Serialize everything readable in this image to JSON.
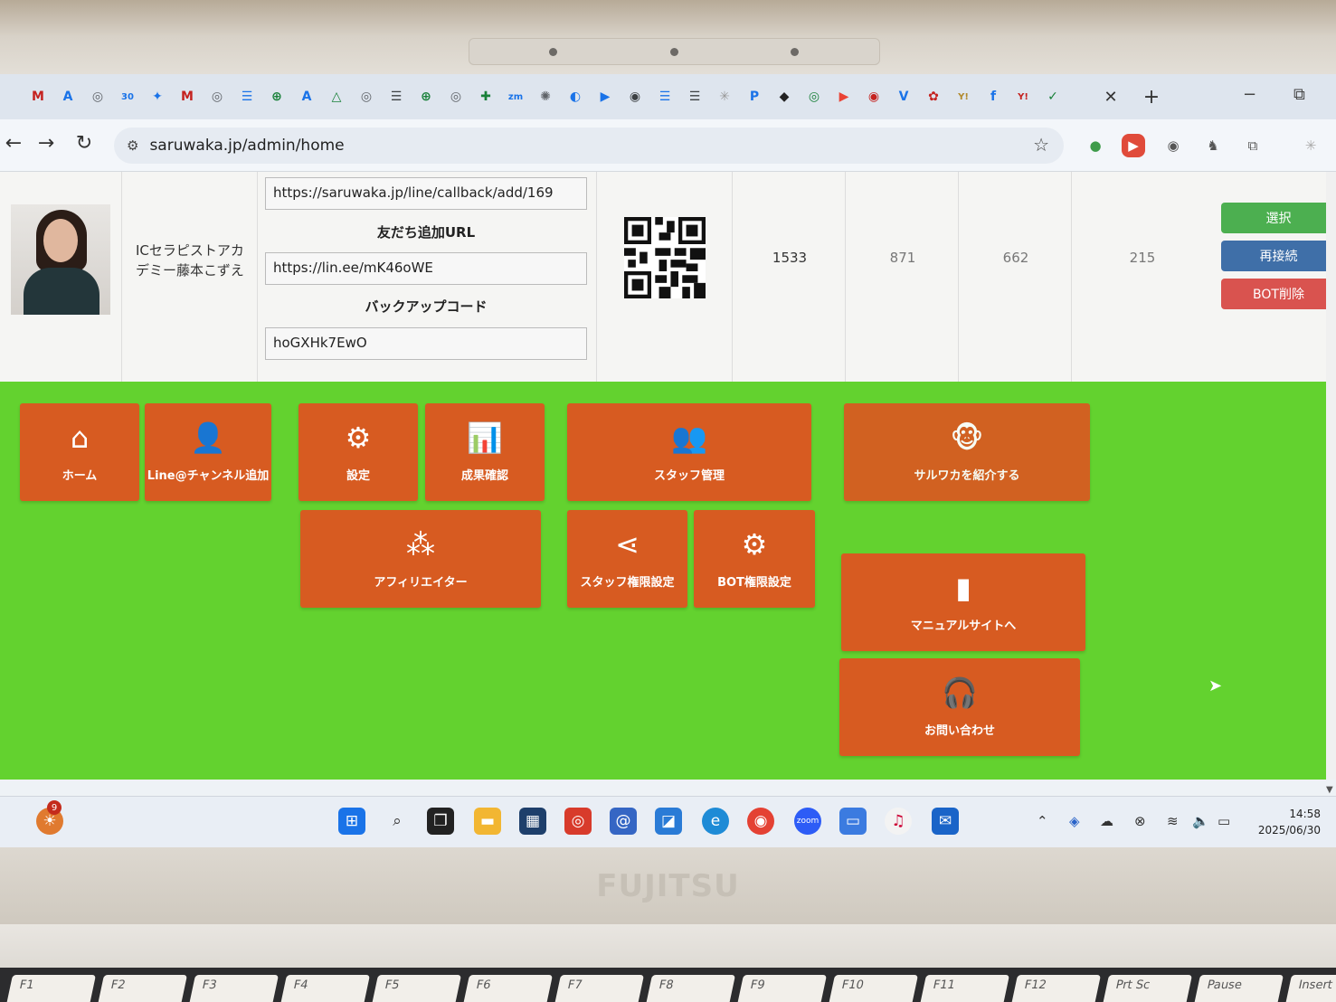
{
  "browser": {
    "tab_favicons": [
      "M",
      "A",
      "◎",
      "30",
      "✦",
      "M",
      "◎",
      "☰",
      "⊕",
      "A",
      "△",
      "◎",
      "☰",
      "⊕",
      "◎",
      "✚",
      "zm",
      "✺",
      "◐",
      "▶",
      "◉",
      "☰",
      "☰",
      "✳",
      "P",
      "◆",
      "◎",
      "▶",
      "◉",
      "V",
      "✿",
      "Y!",
      "f",
      "Y!",
      "✓"
    ],
    "close_icon": "✕",
    "new_tab_icon": "+",
    "minimize": "−",
    "restore": "⧉",
    "url": "saruwaka.jp/admin/home"
  },
  "account": {
    "name": "ICセラピストアカデミー藤本こずえ",
    "callback_url": "https://saruwaka.jp/line/callback/add/169",
    "friend_add_label": "友だち追加URL",
    "friend_add_url": "https://lin.ee/mK46oWE",
    "backup_label": "バックアップコード",
    "backup_code": "hoGXHk7EwO",
    "stats": [
      "1533",
      "871",
      "662",
      "215"
    ]
  },
  "side_buttons": {
    "select": "選択",
    "reconnect": "再接続",
    "delete_bot": "BOT削除"
  },
  "colors": {
    "accent_green": "#63d22f",
    "tile_orange": "#d75b21",
    "btn_green": "#4caf50",
    "btn_blue": "#3f6fa8",
    "btn_red": "#d9534f"
  },
  "menu": {
    "home": "ホーム",
    "add_channel": "Line@チャンネル追加",
    "settings": "設定",
    "results": "成果確認",
    "staff": "スタッフ管理",
    "introduce": "サルワカを紹介する",
    "affiliate": "アフィリエイター",
    "staff_perm": "スタッフ権限設定",
    "bot_perm": "BOT権限設定",
    "manual": "マニュアルサイトへ",
    "contact": "お問い合わせ"
  },
  "taskbar": {
    "badge": "9",
    "time": "14:58",
    "date": "2025/06/30"
  },
  "hardware": {
    "brand": "FUJITSU",
    "fkeys": [
      "F1",
      "F2",
      "F3",
      "F4",
      "F5",
      "F6",
      "F7",
      "F8",
      "F9",
      "F10",
      "F11",
      "F12",
      "Prt Sc",
      "Pause",
      "Insert"
    ]
  }
}
